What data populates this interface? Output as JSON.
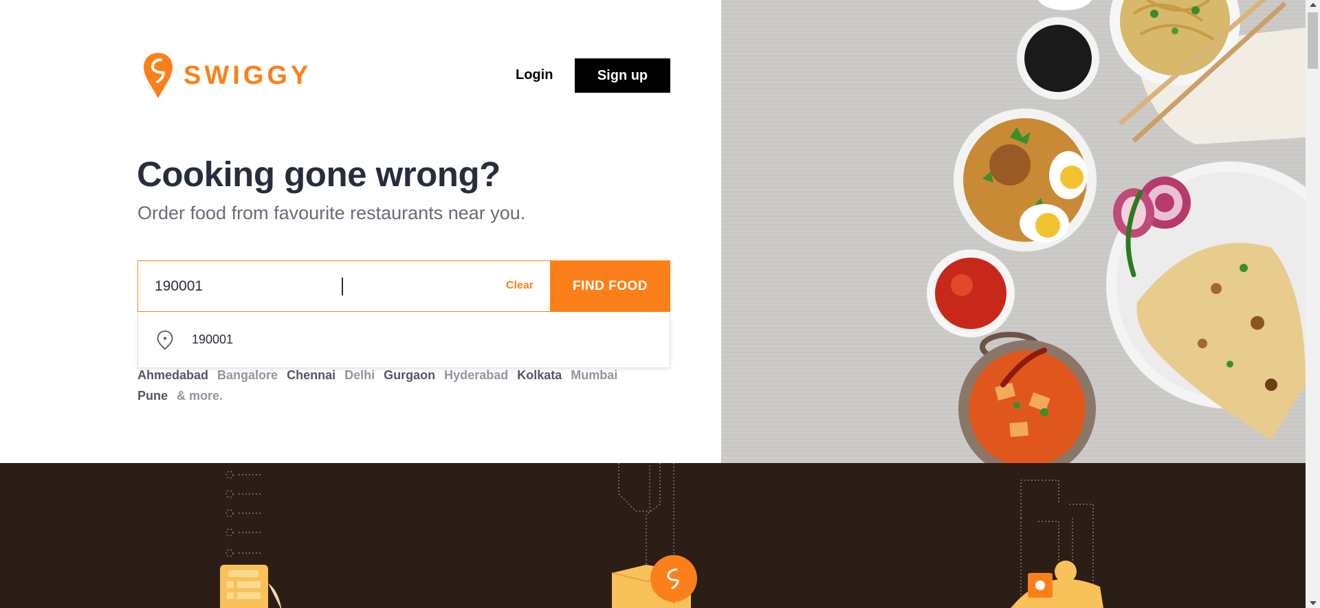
{
  "brand": {
    "name": "SWIGGY",
    "color": "#fc8019",
    "logo_icon": "swiggy-logo-icon"
  },
  "header": {
    "login_label": "Login",
    "signup_label": "Sign up"
  },
  "hero": {
    "headline": "Cooking gone wrong?",
    "subline": "Order food from favourite restaurants near you."
  },
  "search": {
    "value": "190001",
    "clear_label": "Clear",
    "button_label": "FIND FOOD"
  },
  "suggestion": {
    "icon": "location-pin-icon",
    "text": "190001"
  },
  "cities": [
    {
      "name": "Ahmedabad",
      "tone": "dark"
    },
    {
      "name": "Bangalore",
      "tone": "light"
    },
    {
      "name": "Chennai",
      "tone": "dark"
    },
    {
      "name": "Delhi",
      "tone": "light"
    },
    {
      "name": "Gurgaon",
      "tone": "dark"
    },
    {
      "name": "Hyderabad",
      "tone": "light"
    },
    {
      "name": "Kolkata",
      "tone": "dark"
    },
    {
      "name": "Mumbai",
      "tone": "light"
    },
    {
      "name": "Pune",
      "tone": "dark"
    },
    {
      "name": "& more.",
      "tone": "light"
    }
  ],
  "colors": {
    "accent": "#fc8019",
    "dark_text": "#282c3f",
    "muted_text": "#686b78",
    "band": "#2b1e16"
  }
}
